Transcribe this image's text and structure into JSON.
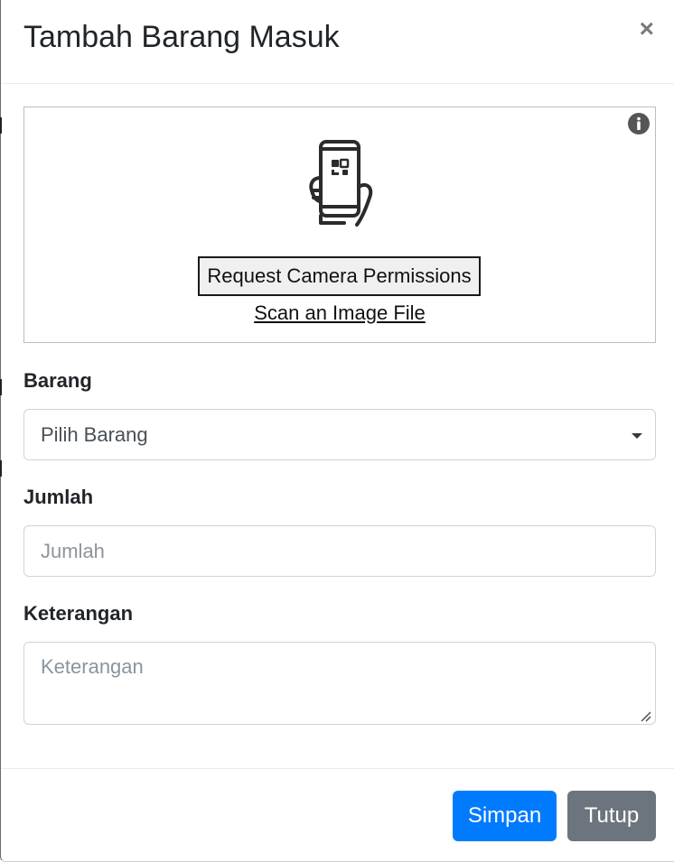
{
  "modal": {
    "title": "Tambah Barang Masuk",
    "close_symbol": "×"
  },
  "scanner": {
    "info_icon": "info-circle-icon",
    "phone_icon": "qr-phone-scan-icon",
    "camera_button_label": "Request Camera Permissions",
    "scan_file_link": "Scan an Image File"
  },
  "form": {
    "barang": {
      "label": "Barang",
      "selected": "Pilih Barang"
    },
    "jumlah": {
      "label": "Jumlah",
      "placeholder": "Jumlah",
      "value": ""
    },
    "keterangan": {
      "label": "Keterangan",
      "placeholder": "Keterangan",
      "value": ""
    }
  },
  "footer": {
    "save_label": "Simpan",
    "close_label": "Tutup"
  },
  "colors": {
    "primary": "#007bff",
    "secondary": "#6c757d"
  }
}
